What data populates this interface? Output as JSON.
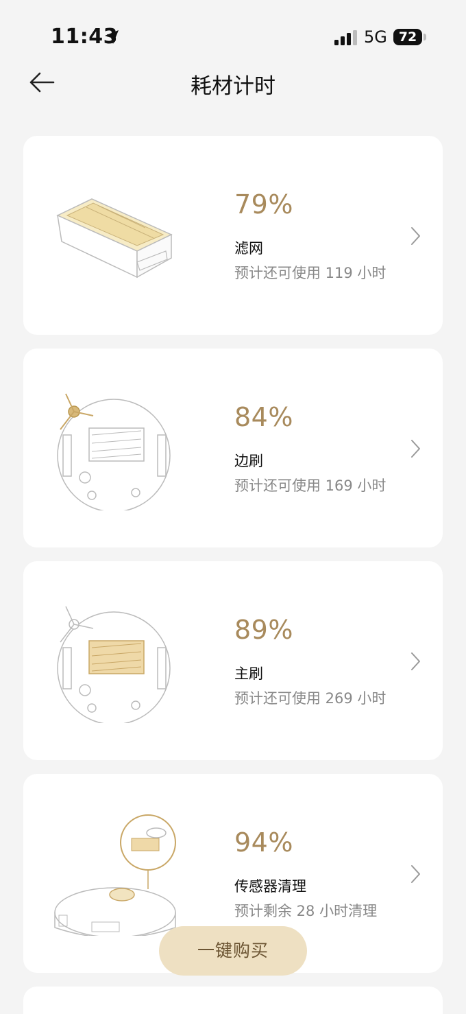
{
  "status_bar": {
    "time": "11:43",
    "network": "5G",
    "battery": "72"
  },
  "header": {
    "title": "耗材计时"
  },
  "consumables": [
    {
      "percent": "79%",
      "name": "滤网",
      "remaining": "预计还可使用 119 小时",
      "icon": "filter-image"
    },
    {
      "percent": "84%",
      "name": "边刷",
      "remaining": "预计还可使用 169 小时",
      "icon": "side-brush-image"
    },
    {
      "percent": "89%",
      "name": "主刷",
      "remaining": "预计还可使用 269 小时",
      "icon": "main-brush-image"
    },
    {
      "percent": "94%",
      "name": "传感器清理",
      "remaining": "预计剩余 28 小时清理",
      "icon": "sensor-image"
    }
  ],
  "buy_button": {
    "label": "一键购买"
  },
  "colors": {
    "accent": "#a88a5c",
    "button_bg": "#eee0c2",
    "background": "#f4f4f4"
  }
}
